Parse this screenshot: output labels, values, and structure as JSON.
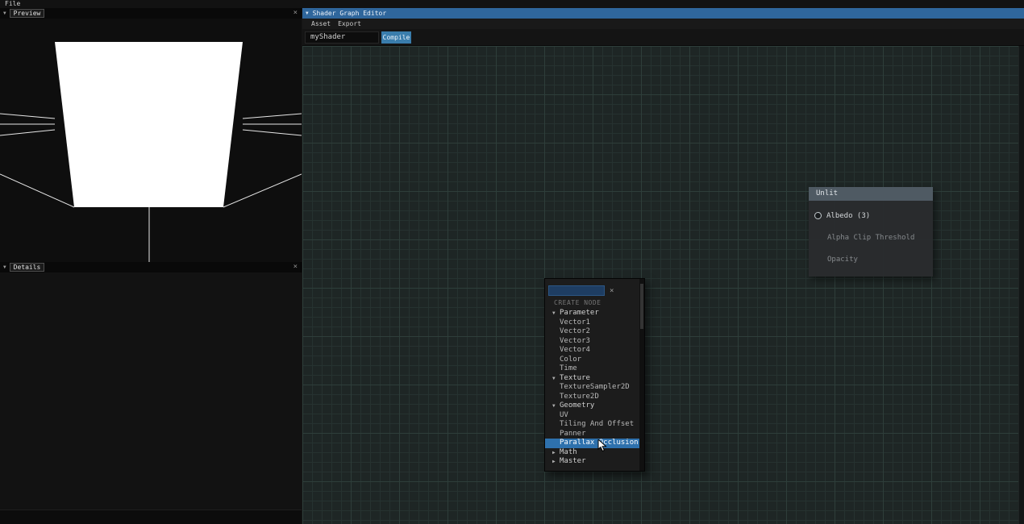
{
  "icons": {
    "panel_chevron": "▼",
    "chevron_down": "▼",
    "chevron_right": "▶"
  },
  "colors": {
    "titlebar_blue": "#2f669c",
    "compile_blue": "#3a7dac",
    "selection_blue": "#2e71ad",
    "search_blue": "#1e3d62",
    "node_header_gray": "#4f5a63",
    "canvas_bg": "#1e2625"
  },
  "app": {
    "file_menu": "File"
  },
  "preview_panel": {
    "title": "Preview",
    "close_label": "×"
  },
  "details_panel": {
    "title": "Details",
    "close_label": "×"
  },
  "shader_window": {
    "tab_title": "Shader Graph Editor",
    "menu_items": [
      "Asset",
      "Export"
    ],
    "shader_name": "myShader",
    "compile_label": "Compile"
  },
  "unlit_node": {
    "title": "Unlit",
    "rows": [
      {
        "label": "Albedo (3)",
        "port": true,
        "muted": false
      },
      {
        "label": "Alpha Clip Threshold",
        "port": false,
        "muted": true
      },
      {
        "label": "Opacity",
        "port": false,
        "muted": true
      }
    ]
  },
  "create_node_menu": {
    "title": "CREATE NODE",
    "search_value": "",
    "close_label": "×",
    "items": [
      {
        "label": "Parameter",
        "kind": "category",
        "expanded": true
      },
      {
        "label": "Vector1",
        "kind": "node"
      },
      {
        "label": "Vector2",
        "kind": "node"
      },
      {
        "label": "Vector3",
        "kind": "node"
      },
      {
        "label": "Vector4",
        "kind": "node"
      },
      {
        "label": "Color",
        "kind": "node"
      },
      {
        "label": "Time",
        "kind": "node"
      },
      {
        "label": "Texture",
        "kind": "category",
        "expanded": true
      },
      {
        "label": "TextureSampler2D",
        "kind": "node"
      },
      {
        "label": "Texture2D",
        "kind": "node"
      },
      {
        "label": "Geometry",
        "kind": "category",
        "expanded": true
      },
      {
        "label": "UV",
        "kind": "node"
      },
      {
        "label": "Tiling And Offset",
        "kind": "node"
      },
      {
        "label": "Panner",
        "kind": "node"
      },
      {
        "label": "Parallax Occlusion",
        "kind": "node",
        "selected": true
      },
      {
        "label": "Math",
        "kind": "category",
        "expanded": false
      },
      {
        "label": "Master",
        "kind": "category",
        "expanded": false
      }
    ]
  }
}
